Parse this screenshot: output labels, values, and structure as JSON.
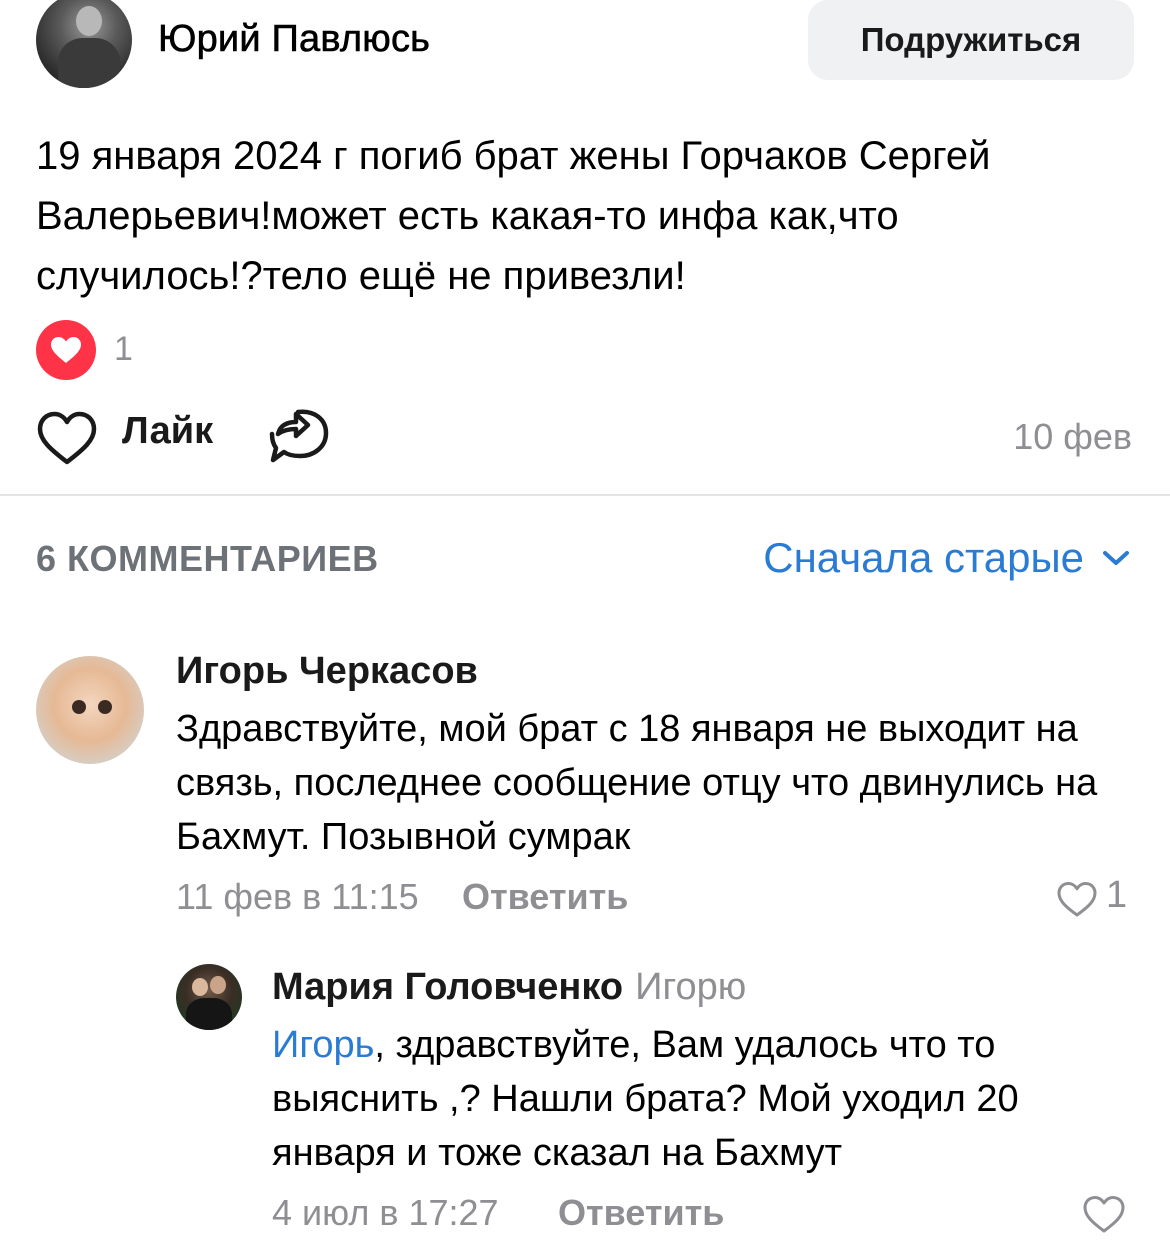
{
  "post": {
    "author": "Юрий Павлюсь",
    "friend_button": "Подружиться",
    "text": "19 января 2024 г погиб брат жены Горчаков Сергей Валерьевич!может есть какая-то инфа как,что случилось!?тело ещё не привезли!",
    "reactions_count": "1",
    "like_label": "Лайк",
    "date": "10 фев",
    "icons": {
      "avatar": "user-avatar",
      "reaction": "heart-icon",
      "like": "heart-outline-icon",
      "share": "share-icon"
    }
  },
  "comments_header": {
    "count_label": "6 КОММЕНТАРИЕВ",
    "sort_label": "Сначала старые",
    "sort_icon": "chevron-down-icon"
  },
  "comments": [
    {
      "author": "Игорь Черкасов",
      "text": "Здравствуйте, мой брат с 18 января не выходит на связь, последнее сообщение отцу что двинулись на Бахмут. Позывной сумрак",
      "date": "11 фев в 11:15",
      "reply_label": "Ответить",
      "likes": "1"
    },
    {
      "author": "Мария Головченко",
      "reply_to": "Игорю",
      "mention": "Игорь",
      "text": ", здравствуйте, Вам удалось что то выяснить ,? Нашли брата? Мой уходил 20 января и тоже сказал на Бахмут",
      "date": "4 июл в 17:27",
      "reply_label": "Ответить"
    }
  ],
  "colors": {
    "accent": "#2a7bd4",
    "reaction": "#ff3347",
    "secondary_text": "#8e8e93",
    "button_bg": "#f0f1f3",
    "divider": "#e4e4e7"
  }
}
